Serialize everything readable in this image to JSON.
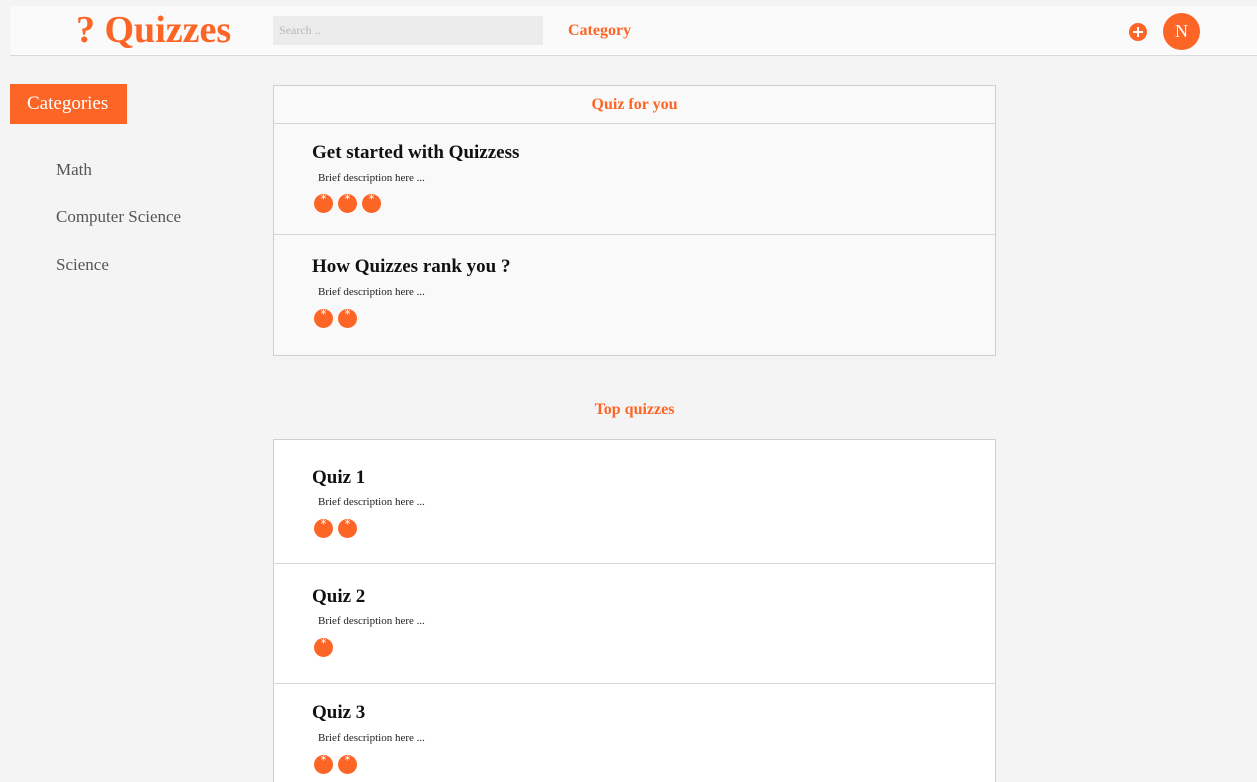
{
  "header": {
    "logo": "? Quizzes",
    "search_placeholder": "Search ..",
    "nav_category": "Category",
    "avatar_initial": "N"
  },
  "sidebar": {
    "title": "Categories",
    "items": [
      {
        "label": "Math"
      },
      {
        "label": "Computer Science"
      },
      {
        "label": "Science"
      }
    ]
  },
  "quiz_for_you": {
    "title": "Quiz for you",
    "quizzes": [
      {
        "title": "Get started with Quizzess",
        "description": "Brief description here ...",
        "stars": 3
      },
      {
        "title": "How Quizzes rank you ?",
        "description": "Brief description here ...",
        "stars": 2
      }
    ]
  },
  "top_quizzes": {
    "title": "Top quizzes",
    "quizzes": [
      {
        "title": "Quiz 1",
        "description": "Brief description here ...",
        "stars": 2
      },
      {
        "title": "Quiz 2",
        "description": "Brief description here ...",
        "stars": 1
      },
      {
        "title": "Quiz 3",
        "description": "Brief description here ...",
        "stars": 2
      }
    ]
  },
  "colors": {
    "accent": "#fd6527",
    "background": "#f4f4f4"
  },
  "icons": {
    "add": "plus-circle-icon",
    "star": "star-badge-icon"
  }
}
